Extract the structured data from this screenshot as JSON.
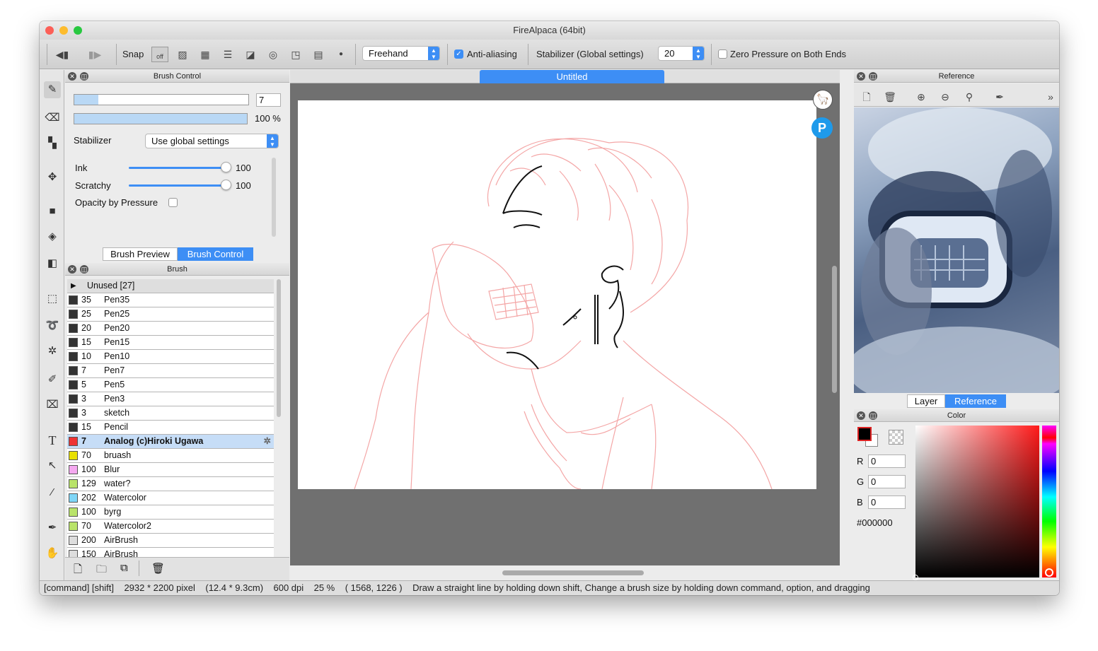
{
  "window": {
    "title": "FireAlpaca (64bit)"
  },
  "toolbar": {
    "snap_label": "Snap",
    "snap_off_label": "off",
    "mode_value": "Freehand",
    "antialias_label": "Anti-aliasing",
    "stabilizer_label": "Stabilizer (Global settings)",
    "stabilizer_value": "20",
    "zero_pressure_label": "Zero Pressure on Both Ends"
  },
  "brush_control": {
    "title": "Brush Control",
    "size_value": "7",
    "opacity_text": "100 %",
    "stabilizer_label": "Stabilizer",
    "stabilizer_value": "Use global settings",
    "ink_label": "Ink",
    "ink_value": "100",
    "scratchy_label": "Scratchy",
    "scratchy_value": "100",
    "opacity_pressure_label": "Opacity by Pressure",
    "tabs": [
      "Brush Preview",
      "Brush Control"
    ]
  },
  "brush_panel": {
    "title": "Brush",
    "group_label": "Unused [27]",
    "items": [
      {
        "size": "35",
        "name": "Pen35",
        "color": "#333333"
      },
      {
        "size": "25",
        "name": "Pen25",
        "color": "#333333"
      },
      {
        "size": "20",
        "name": "Pen20",
        "color": "#333333"
      },
      {
        "size": "15",
        "name": "Pen15",
        "color": "#333333"
      },
      {
        "size": "10",
        "name": "Pen10",
        "color": "#333333"
      },
      {
        "size": "7",
        "name": "Pen7",
        "color": "#333333"
      },
      {
        "size": "5",
        "name": "Pen5",
        "color": "#333333"
      },
      {
        "size": "3",
        "name": "Pen3",
        "color": "#333333"
      },
      {
        "size": "3",
        "name": "sketch",
        "color": "#333333"
      },
      {
        "size": "15",
        "name": "Pencil",
        "color": "#333333"
      },
      {
        "size": "7",
        "name": "Analog (c)Hiroki Ugawa",
        "color": "#ee3333",
        "selected": true
      },
      {
        "size": "70",
        "name": "bruash",
        "color": "#e8e000"
      },
      {
        "size": "100",
        "name": "Blur",
        "color": "#f5a8f0"
      },
      {
        "size": "129",
        "name": "water?",
        "color": "#b9e36a"
      },
      {
        "size": "202",
        "name": "Watercolor",
        "color": "#7fd6f7"
      },
      {
        "size": "100",
        "name": "byrg",
        "color": "#b9e36a"
      },
      {
        "size": "70",
        "name": "Watercolor2",
        "color": "#b9e36a"
      },
      {
        "size": "200",
        "name": "AirBrush",
        "color": "#dddddd"
      },
      {
        "size": "150",
        "name": "AirBrush",
        "color": "#dddddd"
      }
    ]
  },
  "canvas": {
    "tab_title": "Untitled"
  },
  "reference_panel": {
    "title": "Reference",
    "tabs": [
      "Layer",
      "Reference"
    ]
  },
  "color_panel": {
    "title": "Color",
    "r_label": "R",
    "r_value": "0",
    "g_label": "G",
    "g_value": "0",
    "b_label": "B",
    "b_value": "0",
    "hex": "#000000"
  },
  "status_bar": {
    "modifiers": "[command] [shift]",
    "size": "2932 * 2200 pixel",
    "size_cm": "(12.4 * 9.3cm)",
    "dpi": "600 dpi",
    "zoom": "25 %",
    "coords": "( 1568, 1226 )",
    "hint": "Draw a straight line by holding down shift, Change a brush size by holding down command, option, and dragging"
  },
  "colors": {
    "accent": "#3d8ef5",
    "sketch": "#f4a6a6",
    "selected_row": "#c6ddf7"
  }
}
